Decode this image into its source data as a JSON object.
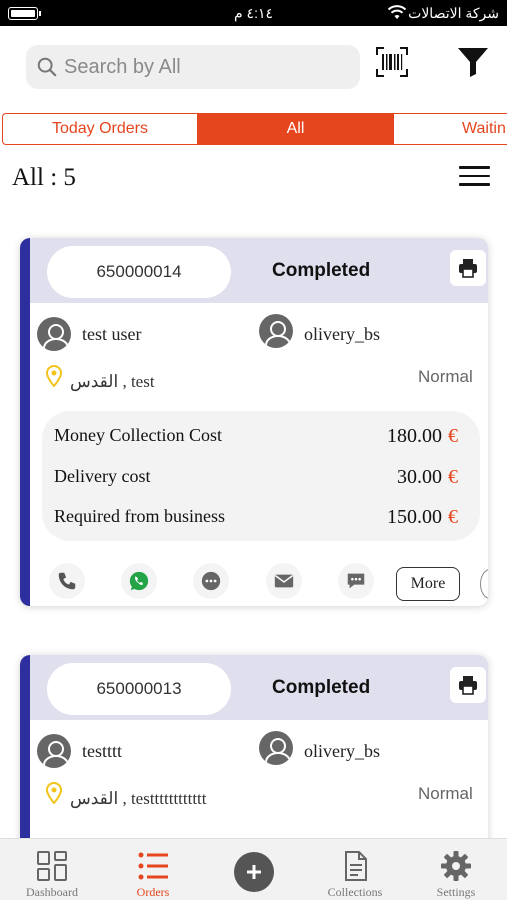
{
  "status_bar": {
    "time": "٤:١٤ م",
    "carrier": "شركة الاتصالات"
  },
  "search": {
    "placeholder": "Search by All"
  },
  "tabs": [
    {
      "label": "Today Orders",
      "active": false
    },
    {
      "label": "All",
      "active": true
    },
    {
      "label": "Waitin",
      "active": false
    }
  ],
  "summary": {
    "count_label": "All : 5"
  },
  "orders": [
    {
      "id": "650000014",
      "status": "Completed",
      "customer": "test user",
      "business": "olivery_bs",
      "address": "القدس , test",
      "priority": "Normal",
      "costs": [
        {
          "label": "Money Collection Cost",
          "value": "180.00"
        },
        {
          "label": "Delivery cost",
          "value": "30.00"
        },
        {
          "label": "Required from business",
          "value": "150.00"
        }
      ],
      "more_label": "More"
    },
    {
      "id": "650000013",
      "status": "Completed",
      "customer": "testttt",
      "business": "olivery_bs",
      "address": "القدس , testttttttttttt",
      "priority": "Normal"
    }
  ],
  "currency_symbol": "€",
  "bottom_nav": [
    {
      "label": "Dashboard",
      "icon": "grid-icon",
      "active": false
    },
    {
      "label": "Orders",
      "icon": "list-icon",
      "active": true
    },
    {
      "label": "Collections",
      "icon": "document-icon",
      "active": false
    },
    {
      "label": "Settings",
      "icon": "gear-icon",
      "active": false
    }
  ],
  "colors": {
    "accent": "#e5461e",
    "card_stripe": "#2c2f9d",
    "card_header": "#dfdfee",
    "whatsapp": "#25a347",
    "location": "#f2c318"
  }
}
